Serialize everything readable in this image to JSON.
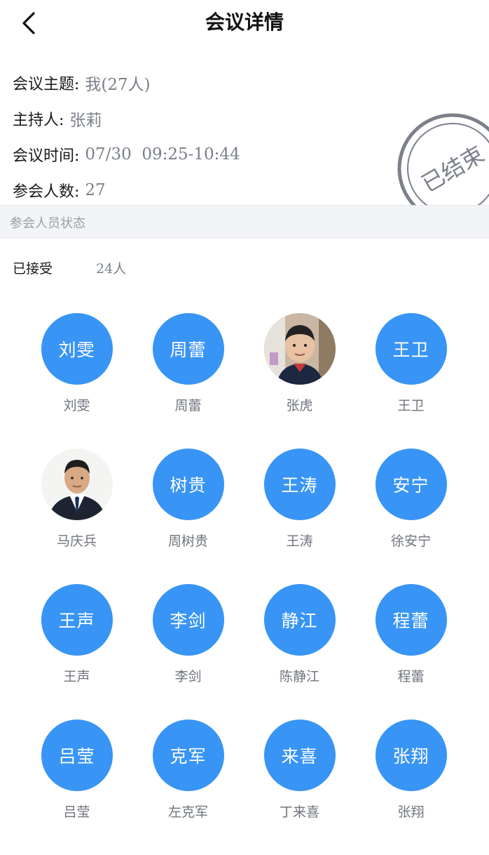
{
  "header": {
    "title": "会议详情"
  },
  "meeting": {
    "topic_label": "会议主题:",
    "topic_value": "我(27人)",
    "host_label": "主持人:",
    "host_value": "张莉",
    "time_label": "会议时间:",
    "time_value": "07/30  09:25-10:44",
    "count_label": "参会人数:",
    "count_value": "27",
    "status_stamp": "已结束"
  },
  "section": {
    "title": "参会人员状态"
  },
  "accepted": {
    "label": "已接受",
    "count": "24人"
  },
  "colors": {
    "avatar_blue": "#3894f5",
    "stamp_gray": "#7c808a",
    "value_gray": "#7a7f88"
  },
  "members": [
    {
      "avatar": "刘雯",
      "name": "刘雯",
      "photo": false
    },
    {
      "avatar": "周蕾",
      "name": "周蕾",
      "photo": false
    },
    {
      "avatar": "",
      "name": "张虎",
      "photo": true,
      "icon": "child-photo-avatar"
    },
    {
      "avatar": "王卫",
      "name": "王卫",
      "photo": false
    },
    {
      "avatar": "",
      "name": "马庆兵",
      "photo": true,
      "icon": "man-in-suit-photo-avatar"
    },
    {
      "avatar": "树贵",
      "name": "周树贵",
      "photo": false
    },
    {
      "avatar": "王涛",
      "name": "王涛",
      "photo": false
    },
    {
      "avatar": "安宁",
      "name": "徐安宁",
      "photo": false
    },
    {
      "avatar": "王声",
      "name": "王声",
      "photo": false
    },
    {
      "avatar": "李剑",
      "name": "李剑",
      "photo": false
    },
    {
      "avatar": "静江",
      "name": "陈静江",
      "photo": false
    },
    {
      "avatar": "程蕾",
      "name": "程蕾",
      "photo": false
    },
    {
      "avatar": "吕莹",
      "name": "吕莹",
      "photo": false
    },
    {
      "avatar": "克军",
      "name": "左克军",
      "photo": false
    },
    {
      "avatar": "来喜",
      "name": "丁来喜",
      "photo": false
    },
    {
      "avatar": "张翔",
      "name": "张翔",
      "photo": false
    }
  ]
}
